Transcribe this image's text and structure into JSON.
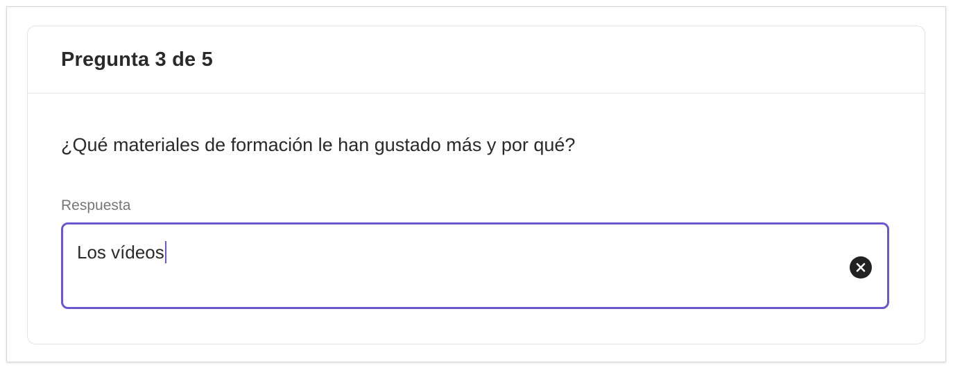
{
  "question_card": {
    "title": "Pregunta 3 de 5",
    "question_text": "¿Qué materiales de formación le han gustado más y por qué?",
    "answer_field": {
      "label": "Respuesta",
      "value": "Los vídeos",
      "clear_icon": "close-circle-icon",
      "focus_color": "#6b56cf"
    }
  }
}
